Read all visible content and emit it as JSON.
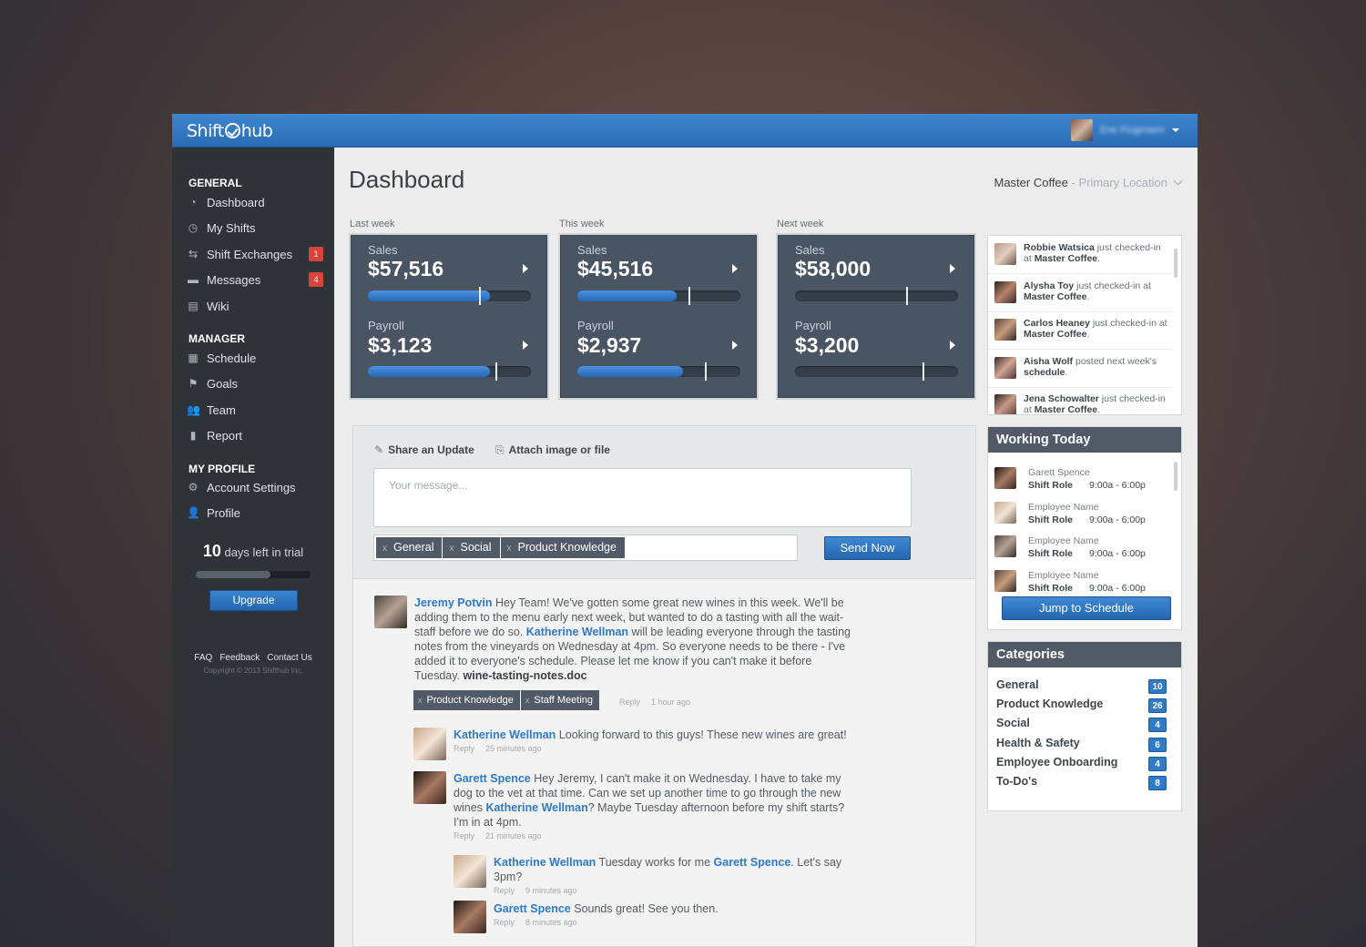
{
  "app": {
    "logo_left": "Shift",
    "logo_right": "hub",
    "user_name": "Eve Flugmann"
  },
  "sidebar": {
    "sections": [
      "GENERAL",
      "MANAGER",
      "MY PROFILE"
    ],
    "general": [
      {
        "label": "Dashboard",
        "icon": "gauge-icon",
        "glyph": "◔"
      },
      {
        "label": "My Shifts",
        "icon": "clock-icon",
        "glyph": "◷"
      },
      {
        "label": "Shift Exchanges",
        "icon": "exchange-icon",
        "glyph": "⇆",
        "badge": "1"
      },
      {
        "label": "Messages",
        "icon": "chat-icon",
        "glyph": "▬",
        "badge": "4"
      },
      {
        "label": "Wiki",
        "icon": "archive-icon",
        "glyph": "▤"
      }
    ],
    "manager": [
      {
        "label": "Schedule",
        "icon": "calendar-icon",
        "glyph": "▦"
      },
      {
        "label": "Goals",
        "icon": "flag-icon",
        "glyph": "⚑"
      },
      {
        "label": "Team",
        "icon": "team-icon",
        "glyph": "👥"
      },
      {
        "label": "Report",
        "icon": "clipboard-icon",
        "glyph": "▮"
      }
    ],
    "profile": [
      {
        "label": "Account Settings",
        "icon": "gear-icon",
        "glyph": "⚙"
      },
      {
        "label": "Profile",
        "icon": "user-icon",
        "glyph": "👤"
      }
    ],
    "trial_days": "10",
    "trial_text": "days left in trial",
    "trial_progress": 0.65,
    "upgrade_label": "Upgrade",
    "footer_links": [
      "FAQ",
      "Feedback",
      "Contact Us"
    ],
    "copyright": "Copyright © 2013 Shifthub Inc."
  },
  "header": {
    "title": "Dashboard",
    "location": "Master Coffee",
    "location_sub": " - Primary Location"
  },
  "weeks": [
    {
      "label": "Last week",
      "sales_label": "Sales",
      "sales": "$57,516",
      "sales_fill": 0.75,
      "sales_target": 0.68,
      "payroll_label": "Payroll",
      "payroll": "$3,123",
      "payroll_fill": 0.75,
      "payroll_target": 0.78
    },
    {
      "label": "This week",
      "sales_label": "Sales",
      "sales": "$45,516",
      "sales_fill": 0.61,
      "sales_target": 0.68,
      "payroll_label": "Payroll",
      "payroll": "$2,937",
      "payroll_fill": 0.65,
      "payroll_target": 0.78
    },
    {
      "label": "Next week",
      "sales_label": "Sales",
      "sales": "$58,000",
      "sales_fill": 0,
      "sales_target": 0.68,
      "payroll_label": "Payroll",
      "payroll": "$3,200",
      "payroll_fill": 0,
      "payroll_target": 0.78
    }
  ],
  "composer": {
    "share_label": "Share an Update",
    "attach_label": "Attach image or file",
    "placeholder": "Your message...",
    "tags": [
      "General",
      "Social",
      "Product Knowledge"
    ],
    "send_label": "Send Now"
  },
  "posts": {
    "p1": {
      "author": "Jeremy Potvin",
      "t1": " Hey Team! We've gotten some great new wines in this week. We'll be adding them to the menu early next week, but wanted to do a tasting with all the wait-staff before we do so. ",
      "mention": "Katherine Wellman",
      "t2": " will be leading everyone through the tasting notes from the vineyards on Wednesday at 4pm. So everyone needs to be there - I've added it to everyone's schedule. Please let me know if you can't make it before Tuesday. ",
      "doc": "wine-tasting-notes.doc",
      "tags": [
        "Product Knowledge",
        "Staff Meeting"
      ],
      "reply": "Reply",
      "time": "1 hour ago"
    },
    "p2": {
      "author": "Katherine Wellman",
      "text": "  Looking forward to this guys! These new wines are great!",
      "reply": "Reply",
      "time": "25 minutes ago"
    },
    "p3": {
      "author": "Garett Spence",
      "t1": "  Hey Jeremy, I can't make it on Wednesday. I have to take my dog to the vet at that time. Can we set up another time to go through the new wines ",
      "mention": "Katherine Wellman",
      "t2": "? Maybe Tuesday afternoon before my shift starts? I'm in at 4pm.",
      "reply": "Reply",
      "time": "21 minutes ago"
    },
    "p4": {
      "author": "Katherine Wellman",
      "t1": "  Tuesday works for me ",
      "mention": "Garett Spence",
      "t2": ". Let's say 3pm?",
      "reply": "Reply",
      "time": "9 minutes ago"
    },
    "p5": {
      "author": "Garett Spence",
      "text": "  Sounds great! See you then.",
      "reply": "Reply",
      "time": "8 minutes ago"
    }
  },
  "activity": [
    {
      "name": "Robbie Watsica",
      "text": " just checked-in at ",
      "place": "Master Coffee",
      "end": "."
    },
    {
      "name": "Alysha Toy",
      "text": " just checked-in at ",
      "place": "Master Coffee",
      "end": "."
    },
    {
      "name": "Carlos Heaney",
      "text": " just checked-in at ",
      "place": "Master Coffee",
      "end": "."
    },
    {
      "name": "Aisha Wolf",
      "text": " posted next week's ",
      "place": "schedule",
      "end": "."
    },
    {
      "name": "Jena Schowalter",
      "text": " just checked-in at ",
      "place": "Master Coffee",
      "end": "."
    }
  ],
  "working": {
    "title": "Working Today",
    "rows": [
      {
        "name": "Garett Spence",
        "role": "Shift Role",
        "time": "9:00a - 6:00p"
      },
      {
        "name": "Employee Name",
        "role": "Shift Role",
        "time": "9:00a - 6:00p"
      },
      {
        "name": "Employee Name",
        "role": "Shift Role",
        "time": "9:00a - 6:00p"
      },
      {
        "name": "Employee Name",
        "role": "Shift Role",
        "time": "9:00a - 6:00p"
      }
    ],
    "button": "Jump to Schedule"
  },
  "categories": {
    "title": "Categories",
    "items": [
      {
        "label": "General",
        "count": "10"
      },
      {
        "label": "Product Knowledge",
        "count": "26"
      },
      {
        "label": "Social",
        "count": "4"
      },
      {
        "label": "Health & Safety",
        "count": "6"
      },
      {
        "label": "Employee Onboarding",
        "count": "4"
      },
      {
        "label": "To-Do's",
        "count": "8"
      }
    ]
  }
}
